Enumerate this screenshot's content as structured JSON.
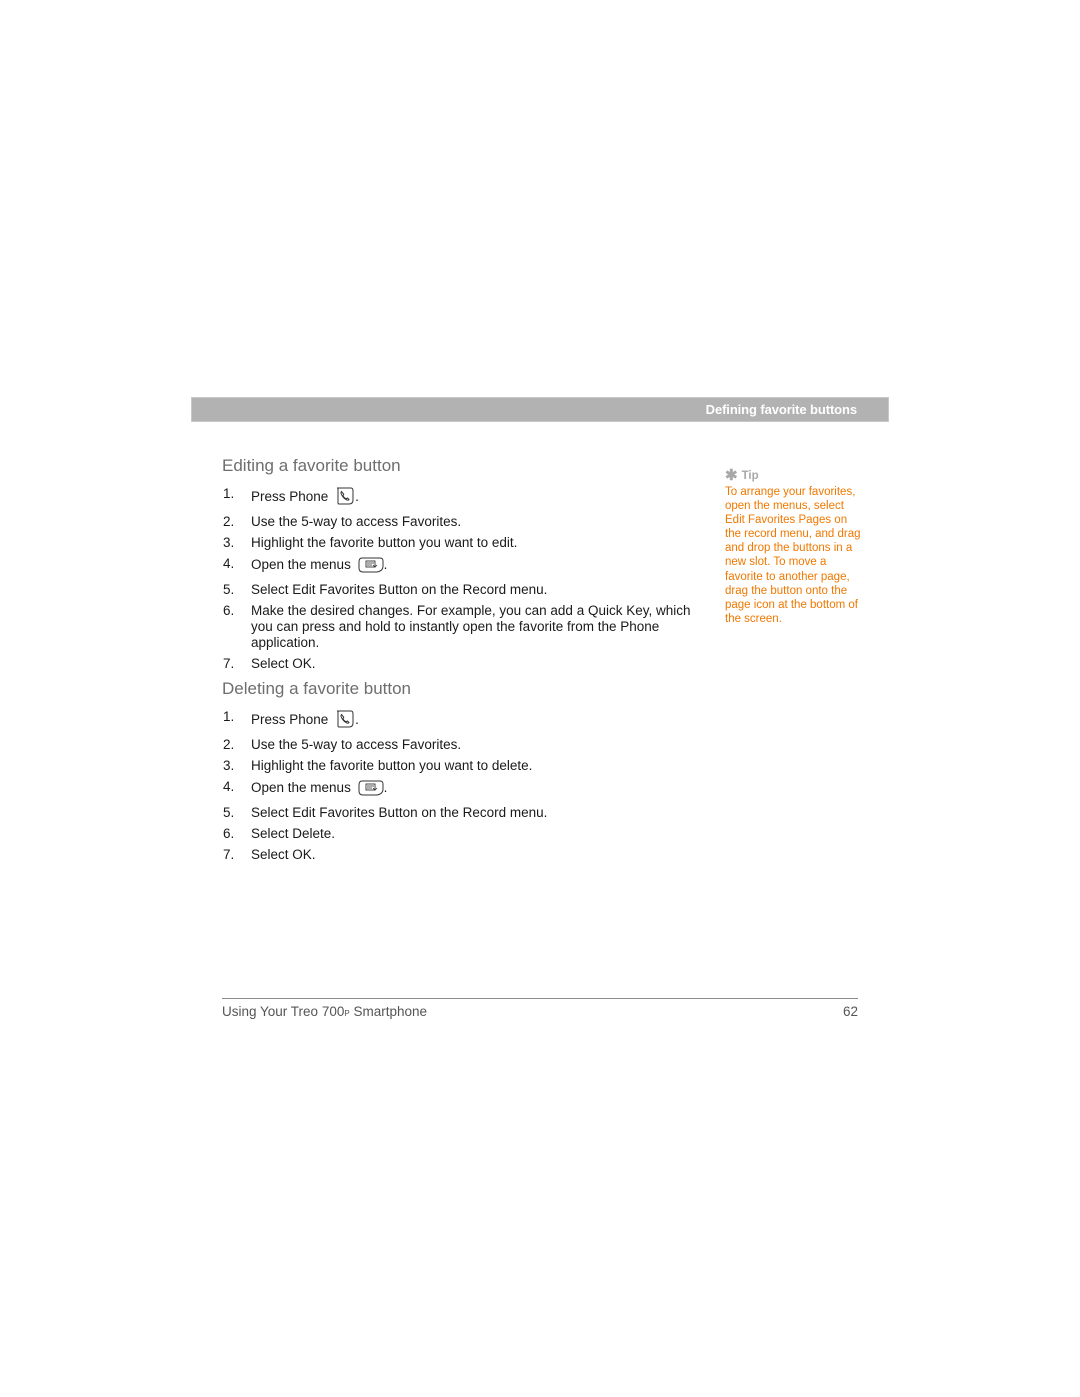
{
  "header": {
    "section_title": "Defining favorite buttons",
    "bar_color": "#b2b2b2"
  },
  "editing": {
    "title": "Editing a favorite button",
    "steps": [
      {
        "num": "1.",
        "text": "Press Phone",
        "icon": "phone-key-icon",
        "suffix": "."
      },
      {
        "num": "2.",
        "text": "Use the 5-way to access Favorites."
      },
      {
        "num": "3.",
        "text": "Highlight the favorite button you want to edit."
      },
      {
        "num": "4.",
        "text": "Open the menus",
        "icon": "menu-key-icon",
        "suffix": "."
      },
      {
        "num": "5.",
        "text": "Select Edit Favorites Button on the Record menu."
      },
      {
        "num": "6.",
        "text": "Make the desired changes. For example, you can add a Quick Key, which you can press and hold to instantly open the favorite from the Phone application."
      },
      {
        "num": "7.",
        "text": "Select OK."
      }
    ]
  },
  "deleting": {
    "title": "Deleting a favorite button",
    "steps": [
      {
        "num": "1.",
        "text": "Press Phone",
        "icon": "phone-key-icon",
        "suffix": "."
      },
      {
        "num": "2.",
        "text": "Use the 5-way to access Favorites."
      },
      {
        "num": "3.",
        "text": "Highlight the favorite button you want to delete."
      },
      {
        "num": "4.",
        "text": "Open the menus",
        "icon": "menu-key-icon",
        "suffix": "."
      },
      {
        "num": "5.",
        "text": "Select Edit Favorites Button on the Record menu."
      },
      {
        "num": "6.",
        "text": "Select Delete."
      },
      {
        "num": "7.",
        "text": "Select OK."
      }
    ]
  },
  "tip": {
    "icon": "asterisk-icon",
    "label": "Tip",
    "body": "To arrange your favorites, open the menus, select Edit Favorites Pages on the record menu, and drag and drop the buttons in a new slot. To move a favorite to another page, drag the button onto the page icon at the bottom of the screen.",
    "color": "#f07800"
  },
  "footer": {
    "title_prefix": "Using Your Treo 700",
    "title_model_suffix": "P",
    "title_suffix": " Smartphone",
    "page_number": "62"
  }
}
